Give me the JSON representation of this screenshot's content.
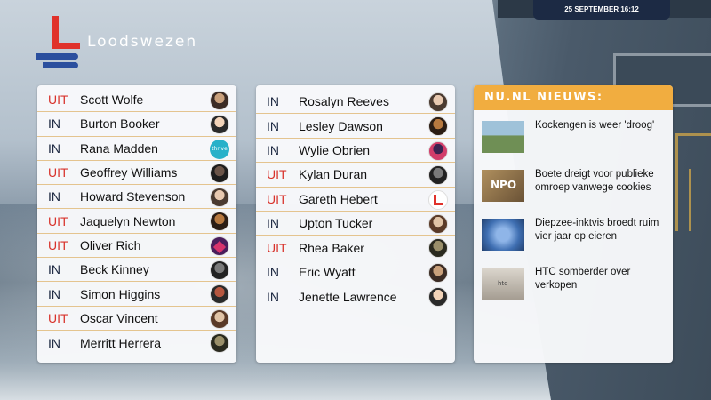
{
  "brand": {
    "name": "Loodswezen"
  },
  "datetime": "25 SEPTEMBER 16:12",
  "colors": {
    "in": "#1b2740",
    "uit": "#d8332c",
    "news_header": "#f1ad40",
    "date_badge": "#1c2a44",
    "row_divider": "#e4c48f"
  },
  "presence_left": [
    {
      "status": "UIT",
      "name": "Scott Wolfe",
      "avatar": "avatar-photo"
    },
    {
      "status": "IN",
      "name": "Burton Booker",
      "avatar": "avatar-photo"
    },
    {
      "status": "IN",
      "name": "Rana Madden",
      "avatar": "avatar-logo-thrive"
    },
    {
      "status": "UIT",
      "name": "Geoffrey Williams",
      "avatar": "avatar-photo"
    },
    {
      "status": "IN",
      "name": "Howard Stevenson",
      "avatar": "avatar-photo"
    },
    {
      "status": "UIT",
      "name": "Jaquelyn Newton",
      "avatar": "avatar-photo"
    },
    {
      "status": "UIT",
      "name": "Oliver Rich",
      "avatar": "avatar-logo"
    },
    {
      "status": "IN",
      "name": "Beck Kinney",
      "avatar": "avatar-photo"
    },
    {
      "status": "IN",
      "name": "Simon Higgins",
      "avatar": "avatar-photo"
    },
    {
      "status": "UIT",
      "name": "Oscar Vincent",
      "avatar": "avatar-photo"
    },
    {
      "status": "IN",
      "name": "Merritt Herrera",
      "avatar": "avatar-photo"
    }
  ],
  "presence_right": [
    {
      "status": "IN",
      "name": "Rosalyn Reeves",
      "avatar": "avatar-photo"
    },
    {
      "status": "IN",
      "name": "Lesley Dawson",
      "avatar": "avatar-photo"
    },
    {
      "status": "IN",
      "name": "Wylie Obrien",
      "avatar": "avatar-photo"
    },
    {
      "status": "UIT",
      "name": "Kylan Duran",
      "avatar": "avatar-photo"
    },
    {
      "status": "UIT",
      "name": "Gareth Hebert",
      "avatar": "avatar-logo"
    },
    {
      "status": "IN",
      "name": "Upton Tucker",
      "avatar": "avatar-photo"
    },
    {
      "status": "UIT",
      "name": "Rhea Baker",
      "avatar": "avatar-photo"
    },
    {
      "status": "IN",
      "name": "Eric Wyatt",
      "avatar": "avatar-photo"
    },
    {
      "status": "IN",
      "name": "Jenette Lawrence",
      "avatar": "avatar-photo"
    }
  ],
  "news": {
    "header": "NU.NL NIEUWS:",
    "items": [
      {
        "title": "Kockengen is weer 'droog'",
        "thumb": "news-thumb-photo"
      },
      {
        "title": "Boete dreigt voor publieke omroep vanwege cookies",
        "thumb": "news-thumb-npo"
      },
      {
        "title": "Diepzee-inktvis broedt ruim vier jaar op eieren",
        "thumb": "news-thumb-photo"
      },
      {
        "title": "HTC somberder over verkopen",
        "thumb": "news-thumb-photo"
      }
    ]
  },
  "thumb_labels": {
    "thrive": "thrive",
    "npo": "NPO",
    "htc": "htc"
  }
}
